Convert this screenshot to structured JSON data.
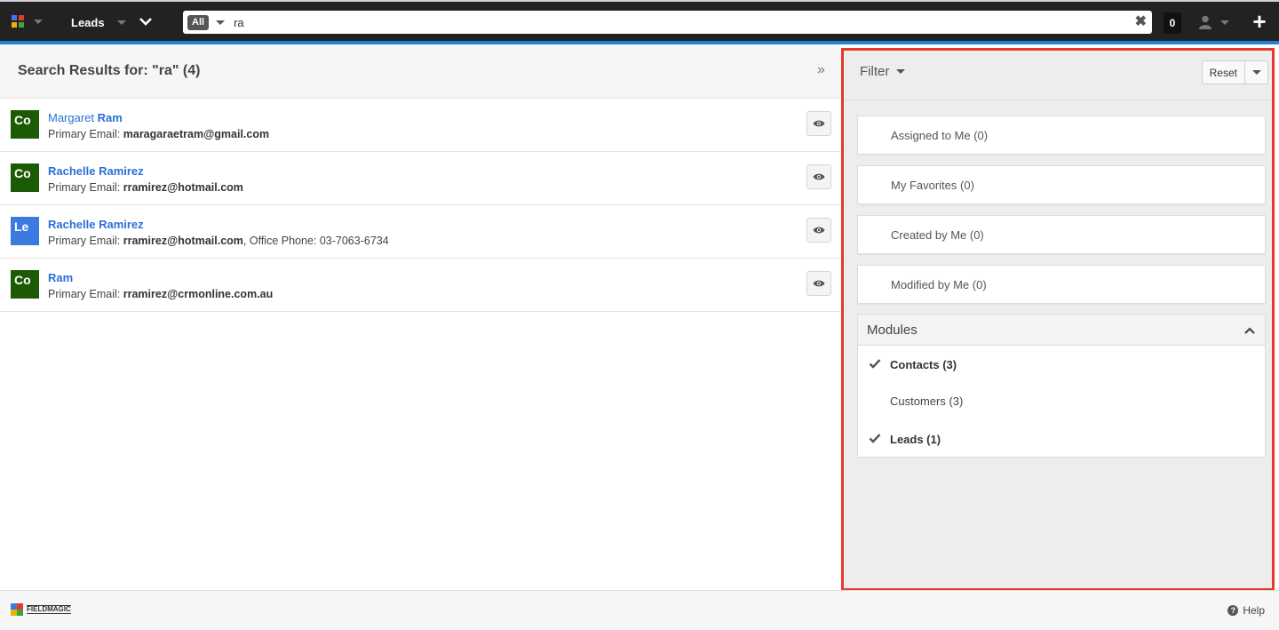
{
  "header": {
    "module_label": "Leads",
    "search": {
      "scope_label": "All",
      "value": "ra",
      "clear_symbol": "✖"
    },
    "notification_count": "0",
    "add_symbol": "+"
  },
  "results": {
    "title": "Search Results for: \"ra\" (4)",
    "collapse_symbol": "»",
    "items": [
      {
        "avatar": "Co",
        "avatar_color": "#1d5a06",
        "name_first": "Margaret",
        "name_last": "Ram",
        "detail_label": "Primary Email:",
        "detail_value": "maragaraetram@gmail.com",
        "detail_extra": ""
      },
      {
        "avatar": "Co",
        "avatar_color": "#1d5a06",
        "name_first": "Rachelle Ramirez",
        "name_last": "",
        "detail_label": "Primary Email:",
        "detail_value": "rramirez@hotmail.com",
        "detail_extra": ""
      },
      {
        "avatar": "Le",
        "avatar_color": "#3b7be0",
        "name_first": "Rachelle Ramirez",
        "name_last": "",
        "detail_label": "Primary Email:",
        "detail_value": "rramirez@hotmail.com",
        "detail_extra": ", Office Phone: 03-7063-6734"
      },
      {
        "avatar": "Co",
        "avatar_color": "#1d5a06",
        "name_first": "Ram",
        "name_last": "",
        "detail_label": "Primary Email:",
        "detail_value": "rramirez@crmonline.com.au",
        "detail_extra": ""
      }
    ]
  },
  "filter": {
    "label": "Filter",
    "reset_label": "Reset",
    "quick_filters": [
      "Assigned to Me (0)",
      "My Favorites (0)",
      "Created by Me (0)",
      "Modified by Me (0)"
    ],
    "modules": {
      "title": "Modules",
      "items": [
        {
          "label": "Contacts (3)",
          "checked": true
        },
        {
          "label": "Customers (3)",
          "checked": false
        },
        {
          "label": "Leads (1)",
          "checked": true
        }
      ]
    }
  },
  "footer": {
    "brand": "FIELDMAGIC",
    "help_label": "Help",
    "help_symbol": "?"
  },
  "colors": {
    "nav_background": "#222222",
    "accent_bar": "#1f82d2",
    "link": "#2b6fd6",
    "highlight_border": "#e8392a",
    "contact_avatar": "#1d5a06",
    "lead_avatar": "#3b7be0"
  },
  "icons": {
    "app_logo": "colored-squares-logo",
    "module_menu": "chevron-down-icon",
    "preview": "eye-icon",
    "user": "user-icon",
    "check": "checkmark-icon",
    "modules_toggle": "chevron-up-icon",
    "help": "question-circle-icon"
  }
}
